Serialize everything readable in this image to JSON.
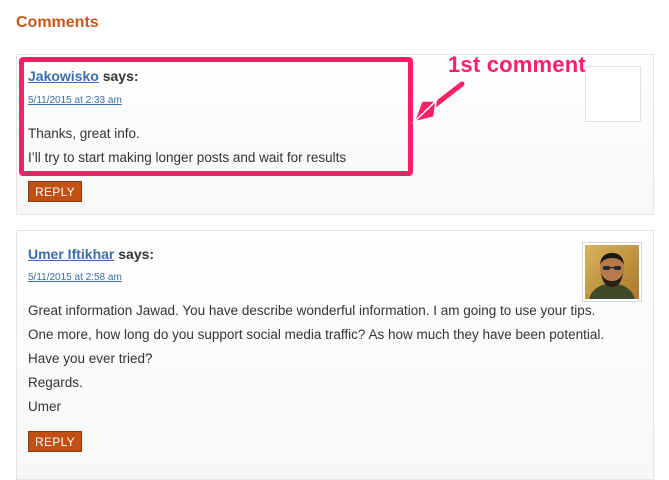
{
  "section": {
    "title": "Comments"
  },
  "comments": [
    {
      "author": "Jakowisko",
      "says": "says:",
      "date": "5/11/2015 at 2:33 am",
      "lines": [
        "Thanks, great info.",
        "I’ll try to start making longer posts and wait for results"
      ],
      "reply_label": "REPLY",
      "avatar": "blank-avatar"
    },
    {
      "author": "Umer Iftikhar",
      "says": "says:",
      "date": "5/11/2015 at 2:58 am",
      "lines": [
        "Great information Jawad. You have describe wonderful information. I am going to use your tips.",
        "One more, how long do you support social media traffic? As how much they have been potential.",
        "Have you ever tried?",
        "Regards.",
        "Umer"
      ],
      "reply_label": "REPLY",
      "avatar": "user-photo-avatar"
    }
  ],
  "annotation": {
    "label": "1st comment",
    "color": "#ff1f66"
  },
  "colors": {
    "title": "#c8571b",
    "link": "#3a6ea8",
    "reply_button": "#c24f14"
  }
}
